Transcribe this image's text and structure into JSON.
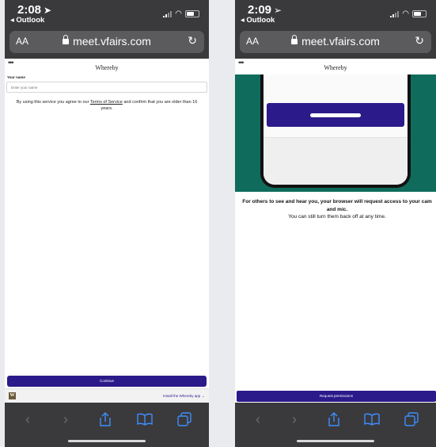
{
  "left": {
    "status": {
      "time": "2:08",
      "back_app": "◂ Outlook"
    },
    "browser": {
      "text_size": "AA",
      "url": "meet.vfairs.com"
    },
    "page": {
      "brand": "Whereby",
      "name_label": "Your name",
      "name_placeholder": "Enter your name",
      "terms_prefix": "By using this service you agree to our ",
      "terms_link": "Terms of Service",
      "terms_suffix": " and confirm that you are older than 16 years.",
      "continue_label": "Continue",
      "app_logo_letter": "W",
      "app_link": "Install the Whereby app →"
    }
  },
  "right": {
    "status": {
      "time": "2:09",
      "back_app": "◂ Outlook"
    },
    "browser": {
      "text_size": "AA",
      "url": "meet.vfairs.com"
    },
    "page": {
      "brand": "Whereby",
      "permission_heading": "For others to see and hear you, your browser will request access to your cam and mic.",
      "permission_sub": "You can still turn them back off at any time.",
      "request_label": "Request permissions"
    }
  },
  "toolbar_icons": [
    "back-icon",
    "forward-icon",
    "share-icon",
    "bookmarks-icon",
    "tabs-icon"
  ],
  "colors": {
    "accent": "#2b1a8a",
    "chrome": "#3a3a3c",
    "link_blue": "#3d8eff",
    "hero_green": "#0f6b5b"
  }
}
